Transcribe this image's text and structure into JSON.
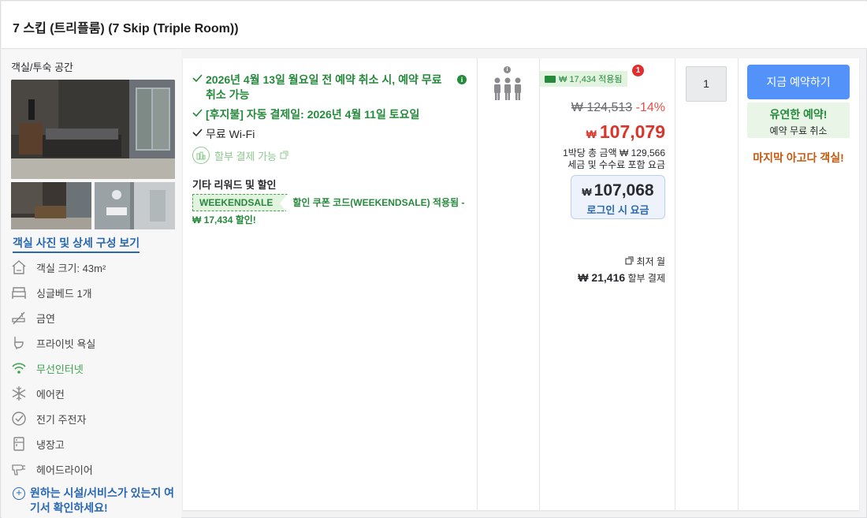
{
  "room_title": "7 스킵 (트리플룸) (7 Skip (Triple Room))",
  "left": {
    "category": "객실/투숙 공간",
    "photo_link": "객실 사진 및 상세 구성 보기",
    "amenities": [
      {
        "icon": "house-size-icon",
        "label": "객실 크기: 43m²"
      },
      {
        "icon": "bed-icon",
        "label": "싱글베드 1개"
      },
      {
        "icon": "no-smoking-icon",
        "label": "금연"
      },
      {
        "icon": "bathtub-icon",
        "label": "프라이빗 욕실"
      },
      {
        "icon": "wifi-icon",
        "label": "무선인터넷"
      },
      {
        "icon": "snowflake-icon",
        "label": "에어컨"
      },
      {
        "icon": "kettle-icon",
        "label": "전기 주전자"
      },
      {
        "icon": "fridge-icon",
        "label": "냉장고"
      },
      {
        "icon": "hairdryer-icon",
        "label": "헤어드라이어"
      }
    ],
    "more_link": "원하는 시설/서비스가 있는지 여기서 확인하세요!"
  },
  "benefits": {
    "items": [
      "2026년 4월 13일 월요일 전 예약 취소 시, 예약 무료 취소 가능",
      "[후지불] 자동 결제일: 2026년 4월 11일 토요일",
      "무료 Wi-Fi"
    ],
    "installment": "할부 결제 가능",
    "other_title": "기타 리워드 및 할인",
    "coupon_code": "WEEKENDSALE",
    "coupon_text": "할인 쿠폰 코드(WEEKENDSALE) 적용됨 - ₩ 17,434 할인!"
  },
  "price": {
    "applied_badge": "₩ 17,434 적용됨",
    "badge_count": "1",
    "original": "₩ 124,513",
    "discount": "-14%",
    "currency": "₩",
    "sale": "107,079",
    "per_night_line1": "1박당 총 금액 ₩ 129,566",
    "per_night_line2": "세금 및 수수료 포함 요금",
    "login_price": "107,068",
    "login_label": "로그인 시 요금",
    "min_month": "최저 월",
    "min_amount": "₩ 21,416",
    "min_suffix": "할부 결제"
  },
  "quantity": "1",
  "booking": {
    "button": "지금 예약하기",
    "flex_title": "유연한 예약!",
    "flex_sub": "예약 무료 취소",
    "last_room": "마지막 아고다 객실!"
  },
  "colors": {
    "primary_blue": "#5392f9",
    "green": "#268a3c",
    "red": "#d9362b",
    "orange": "#c2590f"
  }
}
